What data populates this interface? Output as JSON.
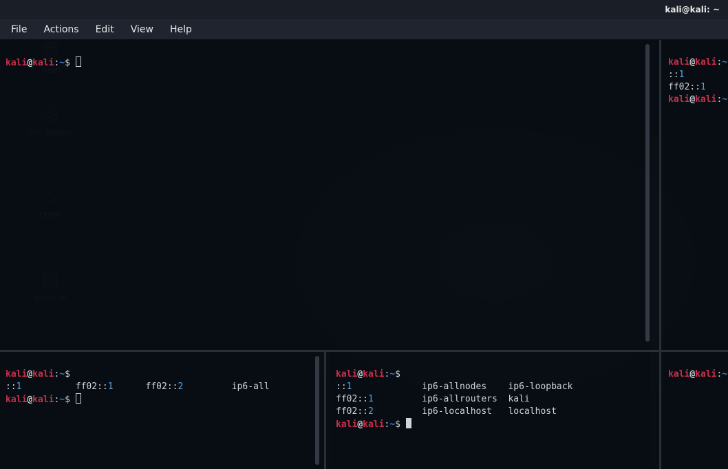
{
  "window": {
    "title": "kali@kali: ~"
  },
  "menu": {
    "file": "File",
    "actions": "Actions",
    "edit": "Edit",
    "view": "View",
    "help": "Help"
  },
  "desktop": {
    "trash": "Trash",
    "filesystem": "File System",
    "home": "Home",
    "scan": "scan1.txt"
  },
  "prompt": {
    "user": "kali",
    "at": "@",
    "host": "kali",
    "colon": ":",
    "cwd": "~",
    "dollar": "$"
  },
  "pane_a": {
    "lines": []
  },
  "pane_b": {
    "out1a": "::",
    "out1b": "1",
    "out2a": "ff02",
    "out2b": "::",
    "out2c": "1"
  },
  "pane_c": {
    "row": {
      "c1a": "::",
      "c1b": "1",
      "c2a": "ff02",
      "c2b": "::",
      "c2c": "1",
      "c3a": "ff02",
      "c3b": "::",
      "c3c": "2",
      "c4": "ip6-all"
    }
  },
  "pane_d": {
    "r1": {
      "a_pre": "::",
      "a_num": "1",
      "b": "ip6-allnodes",
      "c": "ip6-loopback"
    },
    "r2": {
      "a_pre": "ff02",
      "a_mid": "::",
      "a_num": "1",
      "b": "ip6-allrouters",
      "c": "kali"
    },
    "r3": {
      "a_pre": "ff02",
      "a_mid": "::",
      "a_num": "2",
      "b": "ip6-localhost",
      "c": "localhost"
    }
  }
}
